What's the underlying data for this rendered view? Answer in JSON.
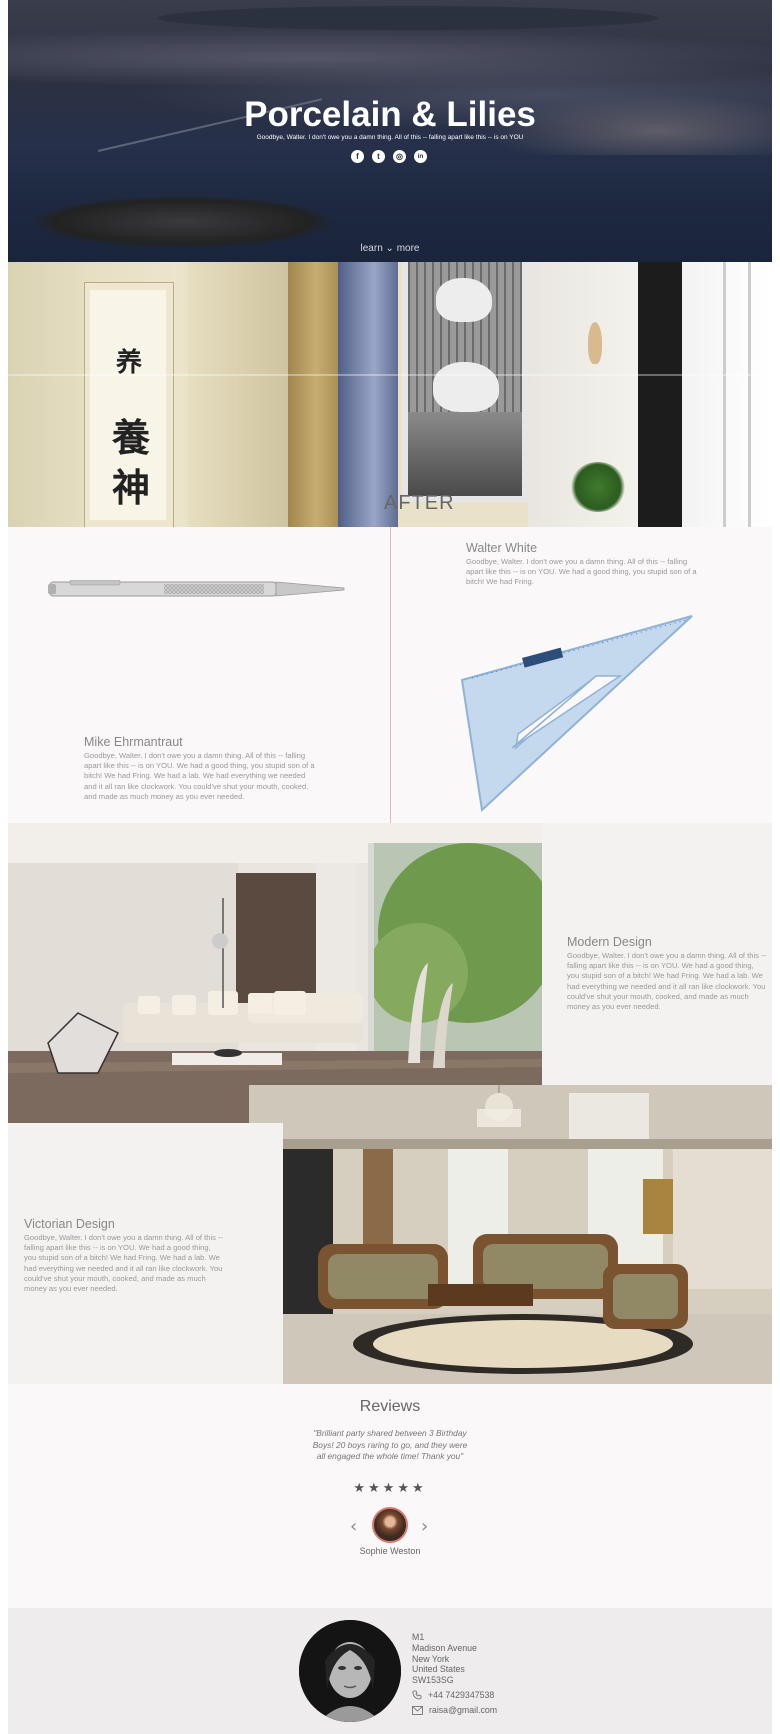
{
  "hero": {
    "title": "Porcelain & Lilies",
    "subtitle": "Goodbye, Walter. I don't owe you a damn thing. All of this -- falling apart like this -- is on YOU",
    "socials": [
      {
        "icon": "facebook-icon",
        "glyph": "f"
      },
      {
        "icon": "twitter-icon",
        "glyph": "t"
      },
      {
        "icon": "instagram-icon",
        "glyph": "◎"
      },
      {
        "icon": "linkedin-icon",
        "glyph": "in"
      }
    ],
    "learn_more": "learn ⌄ more"
  },
  "before_after": {
    "label": "AFTER"
  },
  "tools": {
    "walter": {
      "name": "Walter White",
      "text": "Goodbye, Walter. I don't owe you a damn thing. All of this -- falling apart like this -- is on YOU. We had a good thing, you stupid son of a bitch! We had Fring."
    },
    "mike": {
      "name": "Mike Ehrmantraut",
      "text": "Goodbye, Walter. I don't owe you a damn thing. All of this -- falling apart like this -- is on YOU. We had a good thing, you stupid son of a bitch! We had Fring. We had a lab. We had everything we needed and it all ran like clockwork. You could've shut your mouth, cooked, and made as much money as you ever needed."
    }
  },
  "modern": {
    "title": "Modern Design",
    "text": "Goodbye, Walter. I don't owe you a damn thing. All of this -- falling apart like this -- is on YOU. We had a good thing, you stupid son of a bitch! We had Fring. We had a lab. We had everything we needed and it all ran like clockwork. You could've shut your mouth, cooked, and made as much money as you ever needed."
  },
  "victorian": {
    "title": "Victorian Design",
    "text": "Goodbye, Walter. I don't owe you a damn thing. All of this -- falling apart like this -- is on YOU. We had a good thing, you stupid son of a bitch! We had Fring. We had a lab. We had everything we needed and it all ran like clockwork. You could've shut your mouth, cooked, and made as much money as you ever needed."
  },
  "reviews": {
    "title": "Reviews",
    "quote": "\"Brilliant party shared between 3 Birthday Boys! 20 boys raring to go, and they were all engaged the whole time! Thank you\"",
    "rating": 5,
    "stars": "★★★★★",
    "prev": "‹",
    "next": "›",
    "reviewer": "Sophie Weston"
  },
  "footer": {
    "address": [
      "M1",
      "Madison Avenue",
      "New York",
      "United States",
      "SW153SG"
    ],
    "phone": "+44 7429347538",
    "email": "raisa@gmail.com"
  }
}
